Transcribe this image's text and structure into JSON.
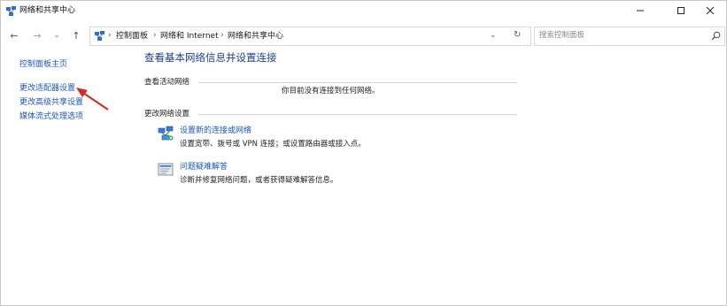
{
  "window": {
    "title": "网络和共享中心",
    "title_icon": "network-center-icon",
    "controls": {
      "minimize": "—",
      "maximize": "☐",
      "close": "✕"
    }
  },
  "nav": {
    "back": "←",
    "forward": "→",
    "recent": "⌄",
    "up": "↑",
    "breadcrumb": [
      "控制面板",
      "网络和 Internet",
      "网络和共享中心"
    ],
    "separator": "›",
    "dropdown": "⌄",
    "refresh": "↻"
  },
  "search": {
    "placeholder": "搜索控制面板",
    "value": "",
    "icon": "search-icon"
  },
  "sidebar": {
    "items": [
      {
        "label": "控制面板主页"
      },
      {
        "label": "更改适配器设置"
      },
      {
        "label": "更改高级共享设置"
      },
      {
        "label": "媒体流式处理选项"
      }
    ]
  },
  "main": {
    "title": "查看基本网络信息并设置连接",
    "active_network_label": "查看活动网络",
    "no_connection": "你目前没有连接到任何网络。",
    "change_settings_label": "更改网络设置",
    "tasks": [
      {
        "icon": "network-setup-icon",
        "link": "设置新的连接或网络",
        "desc": "设置宽带、拨号或 VPN 连接；或设置路由器或接入点。"
      },
      {
        "icon": "troubleshoot-icon",
        "link": "问题疑难解答",
        "desc": "诊断并修复网络问题，或者获得疑难解答信息。"
      }
    ]
  },
  "colors": {
    "link": "#1a57b8",
    "title": "#1e3f8a",
    "arrow": "#d42a1f"
  }
}
